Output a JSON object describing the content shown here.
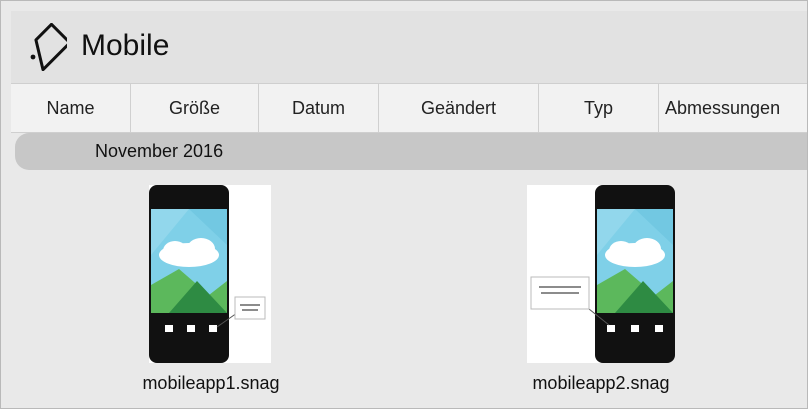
{
  "header": {
    "title": "Mobile",
    "icon": "tag-icon"
  },
  "columns": [
    "Name",
    "Größe",
    "Datum",
    "Geändert",
    "Typ",
    "Abmessungen"
  ],
  "group": {
    "label": "November 2016"
  },
  "items": [
    {
      "filename": "mobileapp1.snag",
      "callout_text": "Take a Photo"
    },
    {
      "filename": "mobileapp2.snag",
      "callout_text": "Import images from your phone"
    }
  ],
  "colors": {
    "header_bg": "#e2e2e2",
    "column_header_bg": "#f2f2f2",
    "group_bar_bg": "#c7c7c7",
    "content_bg": "#e9e9e9",
    "phone_body": "#111111",
    "sky": "#7fd0e8",
    "hill_dark": "#2e8b43",
    "hill_light": "#5cb85c"
  }
}
